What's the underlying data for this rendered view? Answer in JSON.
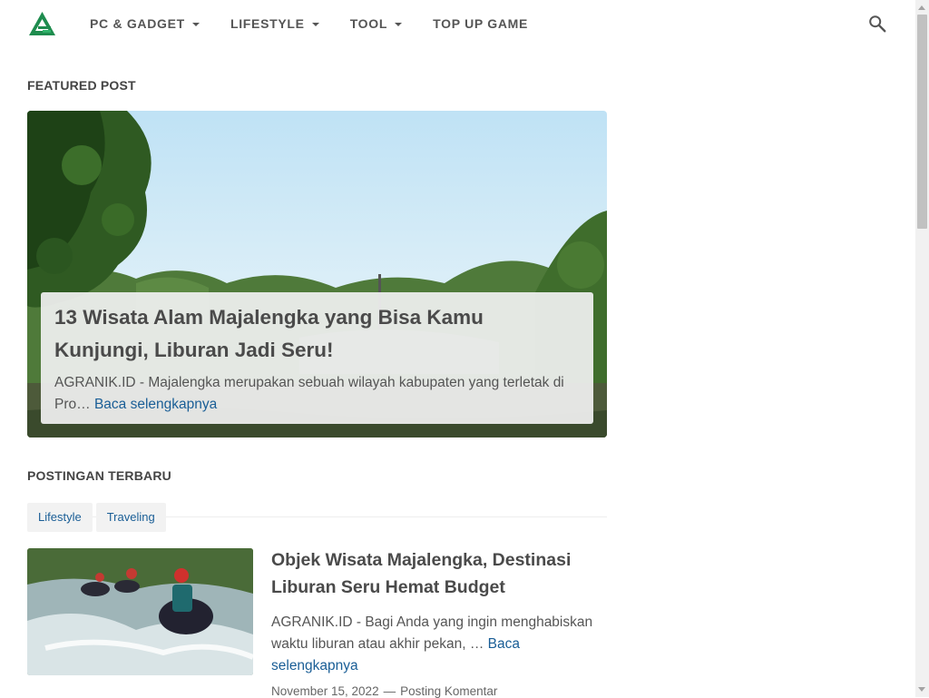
{
  "nav": {
    "items": [
      {
        "label": "PC & GADGET",
        "dropdown": true
      },
      {
        "label": "LIFESTYLE",
        "dropdown": true
      },
      {
        "label": "TOOL",
        "dropdown": true
      },
      {
        "label": "TOP UP GAME",
        "dropdown": false
      }
    ]
  },
  "featured": {
    "heading": "FEATURED POST",
    "title": "13 Wisata Alam Majalengka yang Bisa Kamu Kunjungi, Liburan Jadi Seru!",
    "snippet": "AGRANIK.ID - Majalengka merupakan sebuah wilayah kabupaten yang terletak di Pro…",
    "read_more": "Baca selengkapnya"
  },
  "latest": {
    "heading": "POSTINGAN TERBARU",
    "tags": [
      "Lifestyle",
      "Traveling"
    ],
    "posts": [
      {
        "title": "Objek Wisata Majalengka, Destinasi Liburan Seru Hemat Budget",
        "snippet": "AGRANIK.ID - Bagi Anda yang ingin menghabiskan waktu liburan atau akhir pekan, …",
        "read_more": "Baca selengkapnya",
        "date": "November 15, 2022",
        "separator": "—",
        "comment": "Posting Komentar"
      }
    ]
  },
  "colors": {
    "link": "#1a5e96",
    "logo_green": "#1e8c4e",
    "text": "#555555"
  },
  "icons": {
    "logo": "logo-icon",
    "search": "search-icon"
  }
}
